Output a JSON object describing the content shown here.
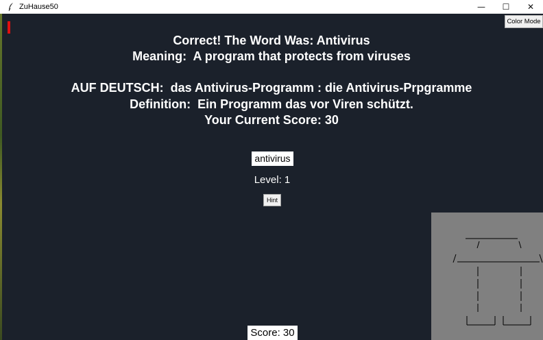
{
  "window": {
    "title": "ZuHause50",
    "minimize_symbol": "—",
    "maximize_symbol": "☐",
    "close_symbol": "✕"
  },
  "toolbar": {
    "color_mode_label": "Color Mode"
  },
  "feedback": {
    "line1": "Correct! The Word Was: Antivirus",
    "line2": "Meaning:  A program that protects from viruses",
    "line3": "AUF DEUTSCH:  das Antivirus-Programm : die Antivirus-Prpgramme",
    "line4": "Definition:  Ein Programm das vor Viren schützt.",
    "line5": "Your Current Score: 30"
  },
  "answer": {
    "value": "antivirus"
  },
  "level": {
    "text": "Level: 1"
  },
  "hint": {
    "label": "Hint"
  },
  "score": {
    "text": "Score: 30"
  },
  "icons": {
    "app": "feather-icon",
    "drawing": "hangman-ascii-drawing"
  },
  "colors": {
    "background": "#1b212b",
    "indicator": "#e01010",
    "panel": "#808080"
  }
}
